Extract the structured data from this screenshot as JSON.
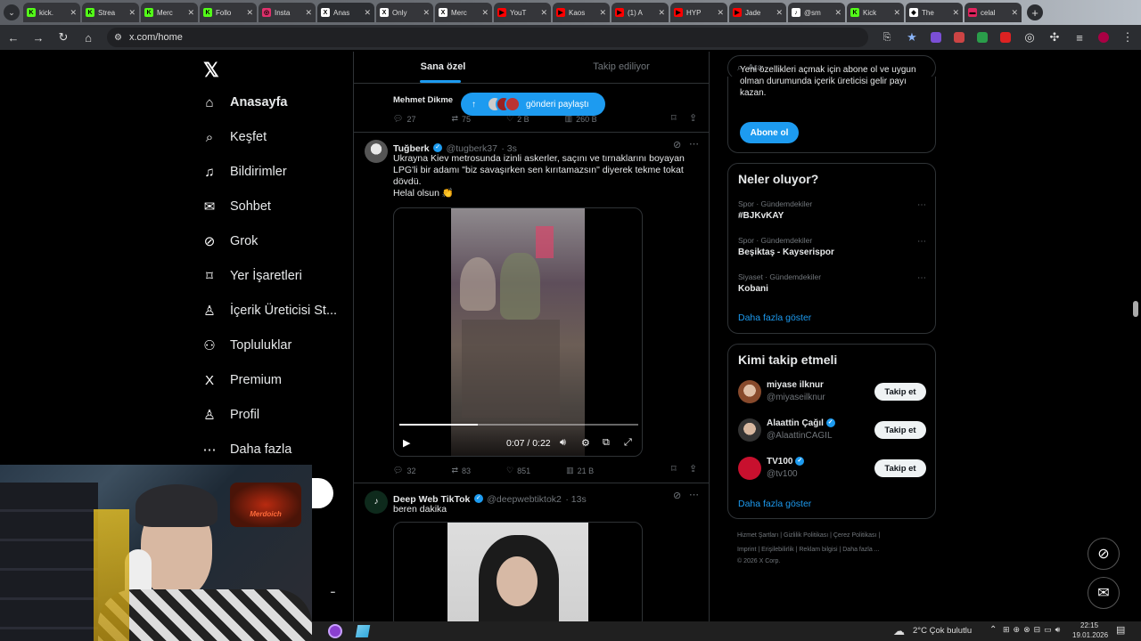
{
  "browser": {
    "tabs": [
      {
        "label": "kick.",
        "fav": "#53fc18",
        "favtext": "K"
      },
      {
        "label": "Strea",
        "fav": "#53fc18",
        "favtext": "K"
      },
      {
        "label": "Merc",
        "fav": "#53fc18",
        "favtext": "K"
      },
      {
        "label": "Follo",
        "fav": "#53fc18",
        "favtext": "K"
      },
      {
        "label": "Insta",
        "fav": "#e1306c",
        "favtext": "◎"
      },
      {
        "label": "Anas",
        "fav": "#ffffff",
        "favtext": "X",
        "active": true
      },
      {
        "label": "Only",
        "fav": "#ffffff",
        "favtext": "X"
      },
      {
        "label": "Merc",
        "fav": "#ffffff",
        "favtext": "X"
      },
      {
        "label": "YouT",
        "fav": "#ff0000",
        "favtext": "▶"
      },
      {
        "label": "Kaos",
        "fav": "#ff0000",
        "favtext": "▶"
      },
      {
        "label": "(1) A",
        "fav": "#ff0000",
        "favtext": "▶"
      },
      {
        "label": "HYP",
        "fav": "#ff0000",
        "favtext": "▶"
      },
      {
        "label": "Jade",
        "fav": "#ff0000",
        "favtext": "▶"
      },
      {
        "label": "@sm",
        "fav": "#ffffff",
        "favtext": "♪"
      },
      {
        "label": "Kick",
        "fav": "#53fc18",
        "favtext": "K"
      },
      {
        "label": "The",
        "fav": "#ffffff",
        "favtext": "◆"
      },
      {
        "label": "celal",
        "fav": "#e0245e",
        "favtext": "▬"
      }
    ],
    "url": "x.com/home"
  },
  "nav": {
    "items": [
      {
        "label": "Anasayfa",
        "icon": "home-icon",
        "glyph": "⌂"
      },
      {
        "label": "Keşfet",
        "icon": "search-icon",
        "glyph": "⌕"
      },
      {
        "label": "Bildirimler",
        "icon": "bell-icon",
        "glyph": "♫"
      },
      {
        "label": "Sohbet",
        "icon": "mail-icon",
        "glyph": "✉"
      },
      {
        "label": "Grok",
        "icon": "grok-icon",
        "glyph": "⊘"
      },
      {
        "label": "Yer İşaretleri",
        "icon": "bookmark-icon",
        "glyph": "⌑"
      },
      {
        "label": "İçerik Üreticisi St...",
        "icon": "creator-icon",
        "glyph": "♙"
      },
      {
        "label": "Topluluklar",
        "icon": "communities-icon",
        "glyph": "⚇"
      },
      {
        "label": "Premium",
        "icon": "x-premium-icon",
        "glyph": "X"
      },
      {
        "label": "Profil",
        "icon": "profile-icon",
        "glyph": "♙"
      },
      {
        "label": "Daha fazla",
        "icon": "more-icon",
        "glyph": "⋯"
      }
    ],
    "more_dots": "..."
  },
  "feed": {
    "tab_for_you": "Sana özel",
    "tab_following": "Takip ediliyor",
    "pill_label": "gönderi paylaştı",
    "top_tweet": {
      "author": "Mehmet Dikme",
      "replies": "27",
      "retweets": "75",
      "likes": "2 B",
      "views": "260 B"
    },
    "tweet1": {
      "name": "Tuğberk",
      "handle": "@tugberk37",
      "time": "· 3s",
      "text": "Ukrayna Kiev metrosunda izinli askerler, saçını ve tırnaklarını boyayan LPG'li bir adamı \"biz savaşırken sen kırıtamazsın\" diyerek tekme tokat dövdü.",
      "text2": "Helal olsun 👏",
      "video_time": "0:07 / 0:22",
      "progress": 0.33,
      "replies": "32",
      "retweets": "83",
      "likes": "851",
      "views": "21 B"
    },
    "tweet2": {
      "name": "Deep Web TikTok",
      "handle": "@deepwebtiktok2",
      "time": "· 13s",
      "text": "beren dakika"
    }
  },
  "sidebar": {
    "search_placeholder": "Ara",
    "premium_text": "Yeni özellikleri açmak için abone ol ve uygun olman durumunda içerik üreticisi gelir payı kazan.",
    "subscribe": "Abone ol",
    "trends_title": "Neler oluyor?",
    "trends": [
      {
        "meta": "Spor · Gündemdekiler",
        "name": "#BJKvKAY"
      },
      {
        "meta": "Spor · Gündemdekiler",
        "name": "Beşiktaş - Kayserispor"
      },
      {
        "meta": "Siyaset · Gündemdekiler",
        "name": "Kobani"
      }
    ],
    "show_more": "Daha fazla göster",
    "follow_title": "Kimi takip etmeli",
    "follow": [
      {
        "name": "miyase ilknur",
        "handle": "@miyaseilknur",
        "verified": false
      },
      {
        "name": "Alaattin Çağıl",
        "handle": "@AlaattinCAGIL",
        "verified": true
      },
      {
        "name": "TV100",
        "handle": "@tv100",
        "verified": true
      }
    ],
    "follow_button": "Takip et",
    "footer1": "Hizmet Şartları  |  Gizlilik Politikası  |  Çerez Politikası  |",
    "footer2": "Imprint  |  Erişilebilirlik  |  Reklam bilgisi  |  Daha fazla ...",
    "footer3": "© 2026 X Corp."
  },
  "taskbar": {
    "weather": "2°C  Çok bulutlu",
    "time": "22:15",
    "date": "19.01.2026"
  },
  "webcam_overlay": "Merdoich"
}
